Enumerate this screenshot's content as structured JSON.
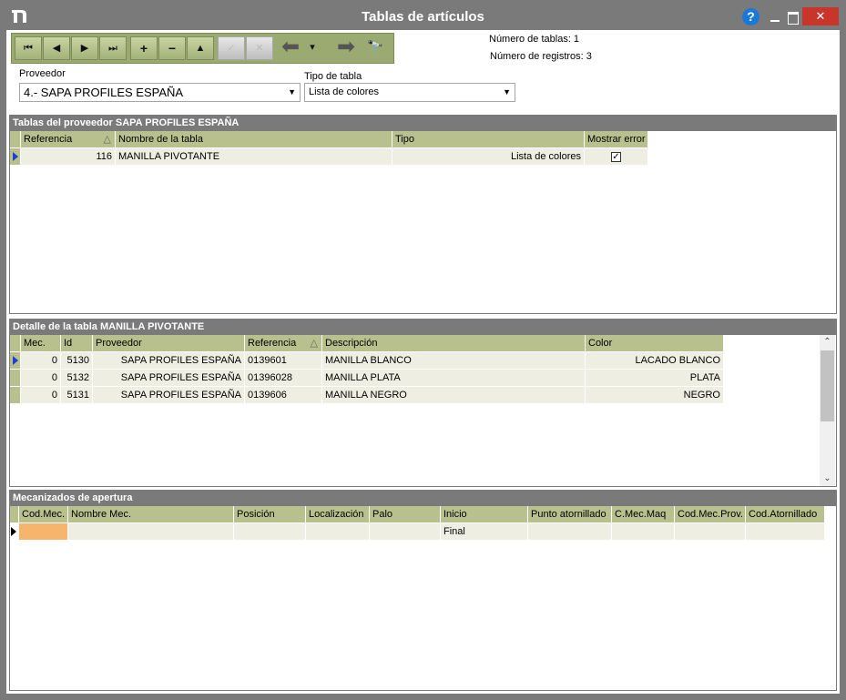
{
  "window": {
    "title": "Tablas de artículos",
    "help_label": "?",
    "close_label": "✕"
  },
  "toolbar": {
    "first": "⏮",
    "prev": "◀",
    "next": "▶",
    "last": "⏭",
    "add": "+",
    "remove": "−",
    "up": "▲",
    "confirm": "✓",
    "cancel": "✕",
    "back": "⬅",
    "dropdown": "▾",
    "forward": "➡",
    "find": "🔭"
  },
  "stats": {
    "num_tablas": "Número de tablas: 1",
    "num_registros": "Número de registros: 3"
  },
  "filters": {
    "proveedor_label": "Proveedor",
    "proveedor_value": "4.- SAPA PROFILES ESPAÑA",
    "tipo_label": "Tipo de tabla",
    "tipo_value": "Lista de colores"
  },
  "tablas": {
    "title": "Tablas del proveedor SAPA PROFILES ESPAÑA",
    "columns": [
      "Referencia",
      "Nombre de la tabla",
      "Tipo",
      "Mostrar error"
    ],
    "rows": [
      {
        "referencia": "116",
        "nombre": "MANILLA PIVOTANTE",
        "tipo": "Lista de colores",
        "mostrar_error": "✓"
      }
    ]
  },
  "detalle": {
    "title": "Detalle de la tabla MANILLA PIVOTANTE",
    "columns": [
      "Mec.",
      "Id",
      "Proveedor",
      "Referencia",
      "Descripción",
      "Color"
    ],
    "rows": [
      {
        "mec": "0",
        "id": "5130",
        "proveedor": "SAPA PROFILES ESPAÑA",
        "referencia": "0139601",
        "descripcion": "MANILLA BLANCO",
        "color": "LACADO BLANCO"
      },
      {
        "mec": "0",
        "id": "5132",
        "proveedor": "SAPA PROFILES ESPAÑA",
        "referencia": "01396028",
        "descripcion": "MANILLA PLATA",
        "color": "PLATA"
      },
      {
        "mec": "0",
        "id": "5131",
        "proveedor": "SAPA PROFILES ESPAÑA",
        "referencia": "0139606",
        "descripcion": "MANILLA NEGRO",
        "color": "NEGRO"
      }
    ]
  },
  "mecanizados": {
    "title": "Mecanizados de apertura",
    "columns": [
      "Cod.Mec.",
      "Nombre Mec.",
      "Posición",
      "Localización",
      "Palo",
      "Inicio",
      "Punto atornillado",
      "C.Mec.Maq",
      "Cod.Mec.Prov.",
      "Cod.Atornillado"
    ],
    "rows": [
      {
        "cod_mec": "",
        "nombre": "",
        "posicion": "",
        "localizacion": "",
        "palo": "",
        "inicio": "Final",
        "punto": "",
        "cmecmaq": "",
        "codmecprov": "",
        "codatornillado": ""
      }
    ]
  },
  "colors": {
    "frame": "#7a7a7a",
    "header_cell": "#b8c08e",
    "row_cell": "#eeefe2",
    "toolbar": "#9aaa70",
    "selected_cell": "#f7b46c"
  }
}
